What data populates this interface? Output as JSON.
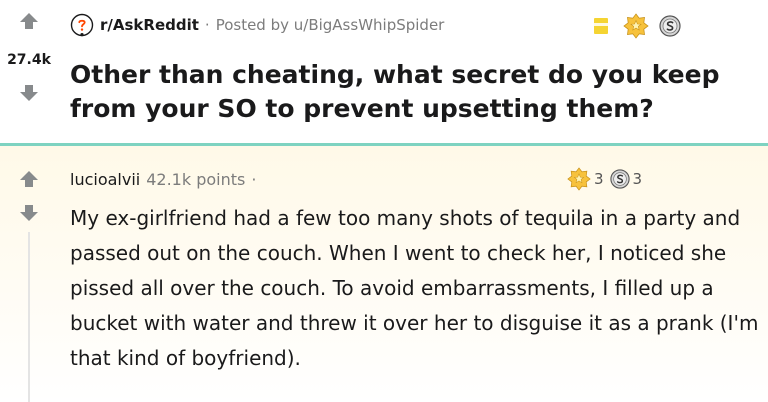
{
  "post": {
    "score": "27.4k",
    "subreddit": "r/AskReddit",
    "posted_by": "Posted by u/BigAssWhipSpider",
    "title": "Other than cheating, what secret do you keep from your SO to prevent upsetting them?",
    "awards": [
      "bookmark-award-icon",
      "gold-award-icon",
      "silver-award-icon"
    ]
  },
  "comment": {
    "user": "lucioalvii",
    "points": "42.1k points",
    "separator": "·",
    "gold_count": "3",
    "silver_count": "3",
    "body": "My ex-girlfriend had a few too many shots of tequila in a party and passed out on the couch. When I went to check her, I noticed she pissed all over the couch. To avoid embarrassments, I filled up a bucket with water and threw it over her to disguise it as a prank (I'm that kind of boyfriend)."
  },
  "colors": {
    "vote_arrow": "#878a8c",
    "divider": "#7ed3c1",
    "gold": "#f7c23c",
    "silver": "#c9c9c9",
    "bookmark": "#f5d432"
  }
}
